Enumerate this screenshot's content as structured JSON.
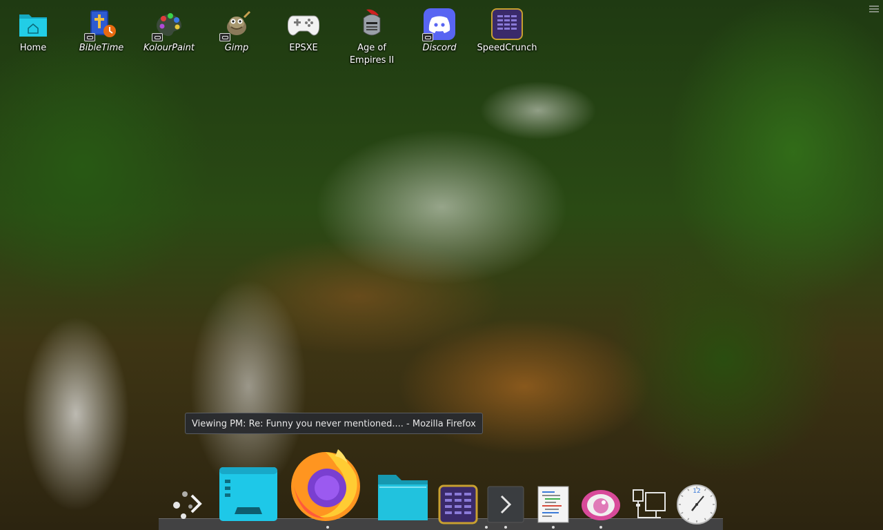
{
  "desktop_icons": [
    {
      "label": "Home",
      "icon": "home-folder-icon",
      "italic": false
    },
    {
      "label": "BibleTime",
      "icon": "bibletime-icon",
      "italic": true
    },
    {
      "label": "KolourPaint",
      "icon": "kolourpaint-icon",
      "italic": true
    },
    {
      "label": "Gimp",
      "icon": "gimp-icon",
      "italic": true
    },
    {
      "label": "EPSXE",
      "icon": "gamepad-icon",
      "italic": false
    },
    {
      "label": "Age of Empires II",
      "icon": "knight-helmet-icon",
      "italic": false
    },
    {
      "label": "Discord",
      "icon": "discord-icon",
      "italic": true
    },
    {
      "label": "SpeedCrunch",
      "icon": "calculator-icon",
      "italic": false
    }
  ],
  "tooltip": {
    "text": "Viewing PM: Re: Funny you never mentioned.... - Mozilla Firefox"
  },
  "dock": {
    "items": [
      {
        "name": "kde-connect",
        "icon": "kde-connect-icon",
        "running": false
      },
      {
        "name": "desktop",
        "icon": "desktop-window-icon",
        "running": true
      },
      {
        "name": "firefox",
        "icon": "firefox-icon",
        "running": true
      },
      {
        "name": "file-manager",
        "icon": "folder-icon",
        "running": false
      },
      {
        "name": "speedcrunch",
        "icon": "calculator-icon",
        "running": false
      },
      {
        "name": "terminal",
        "icon": "terminal-icon",
        "running": true
      },
      {
        "name": "text-editor",
        "icon": "text-editor-icon",
        "running": true
      },
      {
        "name": "image-viewer",
        "icon": "eye-icon",
        "running": true
      },
      {
        "name": "network",
        "icon": "network-icon",
        "running": false
      },
      {
        "name": "clock",
        "icon": "clock-icon",
        "running": false
      }
    ],
    "clock_numeral": "12"
  },
  "colors": {
    "folder_teal": "#1ec8e0",
    "firefox_orange": "#ff7a1a",
    "discord_blurple": "#5865f2",
    "tooltip_bg": "#282a2e"
  }
}
